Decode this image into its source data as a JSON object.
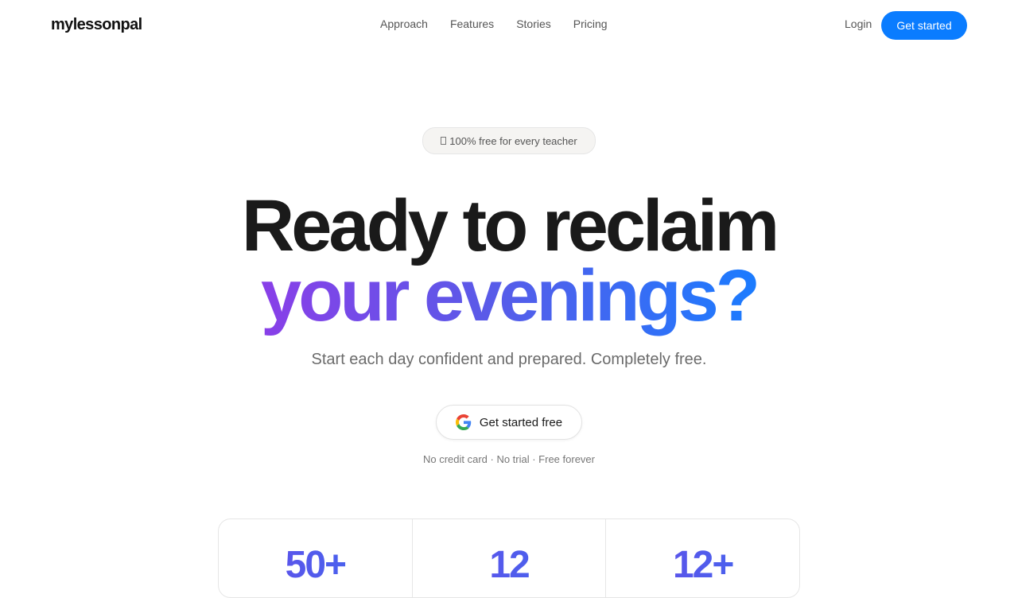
{
  "brand": {
    "logo": "mylessonpal"
  },
  "nav": {
    "links": [
      "Approach",
      "Features",
      "Stories",
      "Pricing"
    ],
    "login": "Login",
    "cta": "Get started"
  },
  "hero": {
    "badge": "100% free for every teacher",
    "headline_line1": "Ready to reclaim",
    "headline_line2": "your evenings?",
    "subtitle": "Start each day confident and prepared. Completely free.",
    "google_button": "Get started free",
    "fineprint": "No credit card · No trial · Free forever"
  },
  "stats": [
    "50+",
    "12",
    "12+"
  ],
  "colors": {
    "accent": "#0a7cff",
    "gradient_start": "#8a3ee8",
    "gradient_end": "#1a7cff"
  }
}
